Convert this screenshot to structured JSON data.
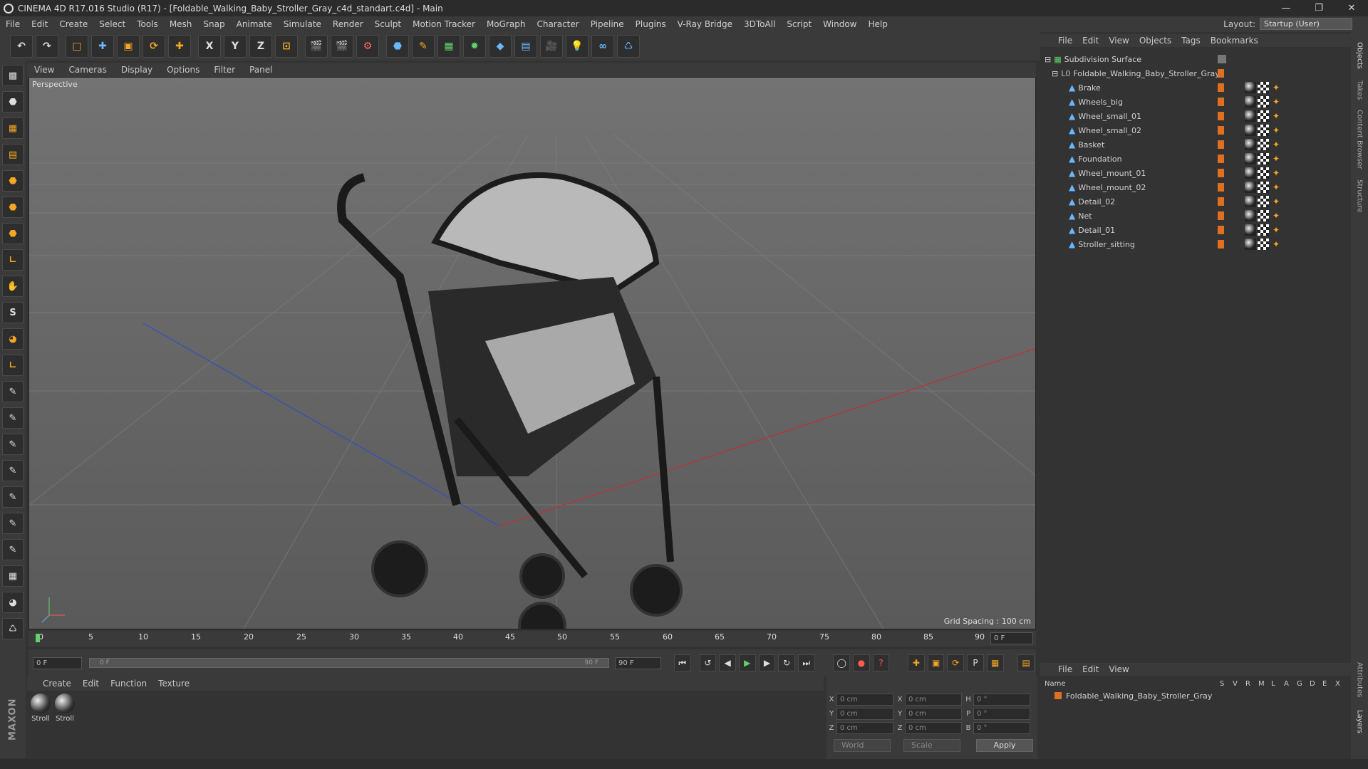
{
  "window": {
    "title": "CINEMA 4D R17.016 Studio (R17) - [Foldable_Walking_Baby_Stroller_Gray_c4d_standart.c4d] - Main"
  },
  "menubar": [
    "File",
    "Edit",
    "Create",
    "Select",
    "Tools",
    "Mesh",
    "Snap",
    "Animate",
    "Simulate",
    "Render",
    "Sculpt",
    "Motion Tracker",
    "MoGraph",
    "Character",
    "Pipeline",
    "Plugins",
    "V-Ray Bridge",
    "3DToAll",
    "Script",
    "Window",
    "Help"
  ],
  "layout": {
    "label": "Layout:",
    "value": "Startup (User)"
  },
  "toolbar": {
    "axis_x": "X",
    "axis_y": "Y",
    "axis_z": "Z"
  },
  "viewport": {
    "menu": [
      "View",
      "Cameras",
      "Display",
      "Options",
      "Filter",
      "Panel"
    ],
    "label": "Perspective",
    "grid_spacing": "Grid Spacing : 100 cm"
  },
  "timeline": {
    "ticks": [
      "0",
      "5",
      "10",
      "15",
      "20",
      "25",
      "30",
      "35",
      "40",
      "45",
      "50",
      "55",
      "60",
      "65",
      "70",
      "75",
      "80",
      "85",
      "90"
    ],
    "end_field": "0 F"
  },
  "transport": {
    "start": "0 F",
    "range_start": "0 F",
    "range_end": "90 F",
    "end": "90 F"
  },
  "material_panel": {
    "menu": [
      "Create",
      "Edit",
      "Function",
      "Texture"
    ],
    "materials": [
      "Stroll",
      "Stroll"
    ]
  },
  "coordinates": {
    "pos": {
      "x": "0 cm",
      "y": "0 cm",
      "z": "0 cm"
    },
    "size": {
      "x": "0 cm",
      "y": "0 cm",
      "z": "0 cm"
    },
    "rot": {
      "h": "0 °",
      "p": "0 °",
      "b": "0 °"
    },
    "mode": "World",
    "type": "Scale",
    "apply": "Apply"
  },
  "object_panel": {
    "menu": [
      "File",
      "Edit",
      "View",
      "Objects",
      "Tags",
      "Bookmarks"
    ],
    "root": "Subdivision Surface",
    "group": "Foldable_Walking_Baby_Stroller_Gray",
    "children": [
      "Brake",
      "Wheels_big",
      "Wheel_small_01",
      "Wheel_small_02",
      "Basket",
      "Foundation",
      "Wheel_mount_01",
      "Wheel_mount_02",
      "Detail_02",
      "Net",
      "Detail_01",
      "Stroller_sitting"
    ]
  },
  "layer_panel": {
    "menu": [
      "File",
      "Edit",
      "View"
    ],
    "header": {
      "name": "Name",
      "cols": [
        "S",
        "V",
        "R",
        "M",
        "L",
        "A",
        "G",
        "D",
        "E",
        "X"
      ]
    },
    "row": "Foldable_Walking_Baby_Stroller_Gray"
  },
  "side_tabs": [
    "Objects",
    "Takes",
    "Content Browser",
    "Structure",
    "Attributes",
    "Layers"
  ],
  "colors": {
    "accent": "#f5a623",
    "layer_orange": "#e07020"
  }
}
